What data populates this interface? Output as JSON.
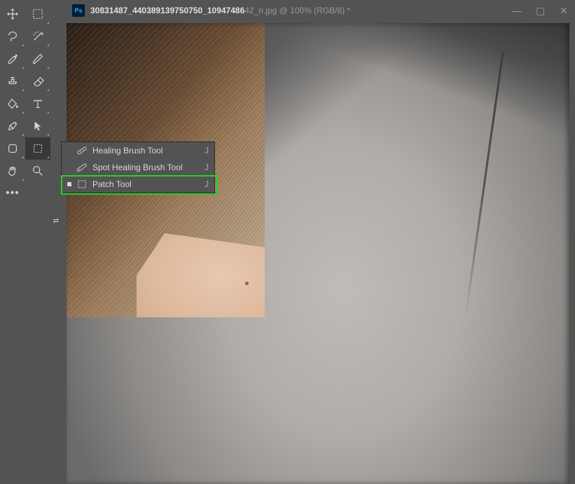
{
  "titlebar": {
    "filename_prefix": "30831487_440389139750750_10947486",
    "filename_suffix": "42_n.jpg @ 100% (RGB/8) *",
    "ps_badge": "Ps"
  },
  "tools": {
    "row1": [
      "move-tool",
      "marquee-tool"
    ],
    "row2": [
      "lasso-tool",
      "magic-wand-tool"
    ],
    "row3": [
      "eyedropper-tool",
      "brush-tool"
    ],
    "row4": [
      "clone-stamp-tool",
      "eraser-tool"
    ],
    "row5": [
      "paint-bucket-tool",
      "type-tool"
    ],
    "row6": [
      "pen-tool",
      "path-selection-tool"
    ],
    "row7": [
      "shape-tool",
      "healing-tool"
    ],
    "row8": [
      "hand-tool",
      "zoom-tool"
    ],
    "row9": [
      "more-tools",
      ""
    ]
  },
  "flyout": [
    {
      "label": "Healing Brush Tool",
      "key": "J",
      "sel": false
    },
    {
      "label": "Spot Healing Brush Tool",
      "key": "J",
      "sel": false
    },
    {
      "label": "Patch Tool",
      "key": "J",
      "sel": true
    }
  ],
  "colors": {
    "fg": "#5b87b8",
    "bg": "#7dcfe8"
  }
}
